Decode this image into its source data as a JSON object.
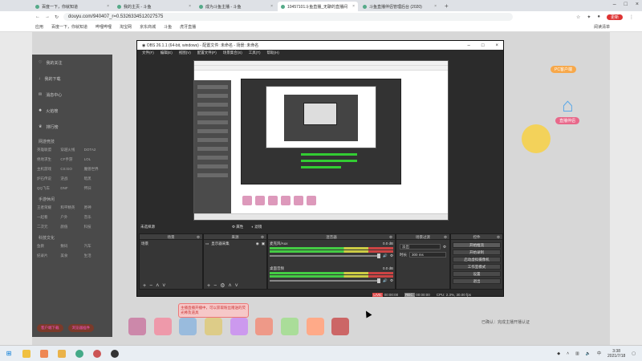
{
  "browser": {
    "tabs": [
      {
        "label": "百度一下，你就知道"
      },
      {
        "label": "我的主页 - 斗鱼"
      },
      {
        "label": "成为斗鱼主播 - 斗鱼"
      },
      {
        "label": "10457101斗鱼直播_无聊的直播间"
      },
      {
        "label": "斗鱼直播伴侣管理后台 (2020)"
      }
    ],
    "url": "douyu.com/940407_r=0.5326334512027575",
    "bookmarks": [
      "应用",
      "百度一下，你就知道",
      "哔哩哔哩",
      "淘宝网",
      "京东商城",
      "斗鱼",
      "虎牙直播"
    ],
    "bookmarks_right": "阅读清单",
    "ext_label": "更新"
  },
  "page": {
    "leftbar_items": [
      "我的关注",
      "我的下载",
      "消息中心",
      "火焰榜",
      "排行榜"
    ],
    "leftbar_section1_title": "网游竞技",
    "leftbar_grid1": [
      "英雄联盟",
      "穿越火线",
      "DOTA2",
      "绝地求生",
      "CF手游",
      "LOL",
      "主机游戏",
      "CS:GO",
      "魔兽世界",
      "炉石传说",
      "逆战",
      "暗黑",
      "QQ飞车",
      "DNF",
      "怀旧"
    ],
    "leftbar_section2_title": "手游休闲",
    "leftbar_grid2": [
      "王者荣耀",
      "和平精英",
      "原神",
      "一起看",
      "户外",
      "音乐",
      "二次元",
      "颜值",
      "科技"
    ],
    "leftbar_section3_title": "科技文化",
    "leftbar_grid3": [
      "鱼教",
      "数码",
      "汽车",
      "纪录片",
      "美食",
      "生活"
    ],
    "leftbar_buttons": [
      "客户端下载",
      "浏览器插件"
    ],
    "red_notice": "主播直播开播中，可以获取粉丝赠送的荧光棒及道具",
    "pills": [
      "PC客户端",
      "直播伴侣"
    ],
    "right_bottom_text": "已确认：完成主播开播认证"
  },
  "obs": {
    "title": "OBS 26.1.1 (64-bit, windows) - 配置文件: 未命名 - 场景: 未命名",
    "menu": [
      "文件(F)",
      "编辑(E)",
      "视图(V)",
      "配置文件(P)",
      "场景集合(S)",
      "工具(T)",
      "帮助(H)"
    ],
    "scene_bar_label": "未选择源",
    "scene_bar_toggles": [
      "属性",
      "滤镜"
    ],
    "docks": {
      "scenes": {
        "title": "场景",
        "items": [
          "场景"
        ]
      },
      "sources": {
        "title": "来源",
        "items": [
          "显示器采集"
        ]
      },
      "mixer": {
        "title": "混音器",
        "channels": [
          {
            "name": "麦克风/Aux",
            "db": "0.0 dB"
          },
          {
            "name": "桌面音频",
            "db": "0.0 dB"
          }
        ]
      },
      "transitions": {
        "title": "场景过渡",
        "type": "淡出",
        "duration_label": "时长",
        "duration": "300 ms"
      },
      "controls": {
        "title": "控件",
        "buttons": [
          "开始推流",
          "开始录制",
          "启动虚拟摄像机",
          "工作室模式",
          "设置",
          "退出"
        ]
      }
    },
    "status": {
      "live_label": "LIVE:",
      "live_time": "00:00:00",
      "rec_label": "REC:",
      "rec_time": "00:00:00",
      "cpu": "CPU: 2.3%, 30.00 fps"
    }
  },
  "taskbar": {
    "time": "3:38",
    "date": "2021/7/18"
  }
}
